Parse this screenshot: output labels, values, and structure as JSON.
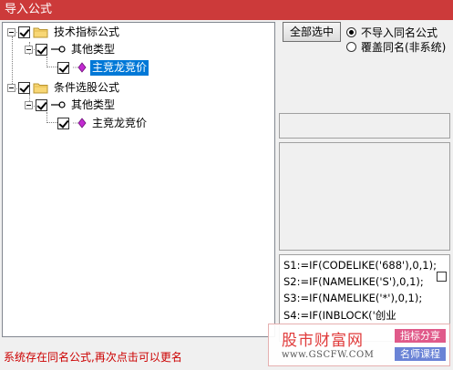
{
  "window": {
    "title": "导入公式"
  },
  "tree": {
    "nodes": [
      {
        "label": "技术指标公式"
      },
      {
        "label": "其他类型"
      },
      {
        "label": "主竞龙竞价"
      },
      {
        "label": "条件选股公式"
      },
      {
        "label": "其他类型"
      },
      {
        "label": "主竞龙竞价"
      }
    ]
  },
  "actions": {
    "select_all": "全部选中"
  },
  "options": {
    "no_import": "不导入同名公式",
    "overwrite": "覆盖同名(非系统)",
    "selected": "no_import"
  },
  "code": {
    "lines": [
      "S1:=IF(CODELIKE('688'),0,1);",
      "S2:=IF(NAMELIKE('S'),0,1);",
      "S3:=IF(NAMELIKE('*'),0,1);",
      "S4:=IF(INBLOCK('创业"
    ]
  },
  "status": {
    "message": "系统存在同名公式,再次点击可以更名"
  },
  "watermark": {
    "title": "股市财富网",
    "url": "www.GSCFW.COM",
    "badge1": "指标分享",
    "badge2": "名师课程"
  },
  "colors": {
    "title_bar": "#cc3a3a",
    "selection": "#0078d7",
    "status_text": "#cc0000"
  }
}
